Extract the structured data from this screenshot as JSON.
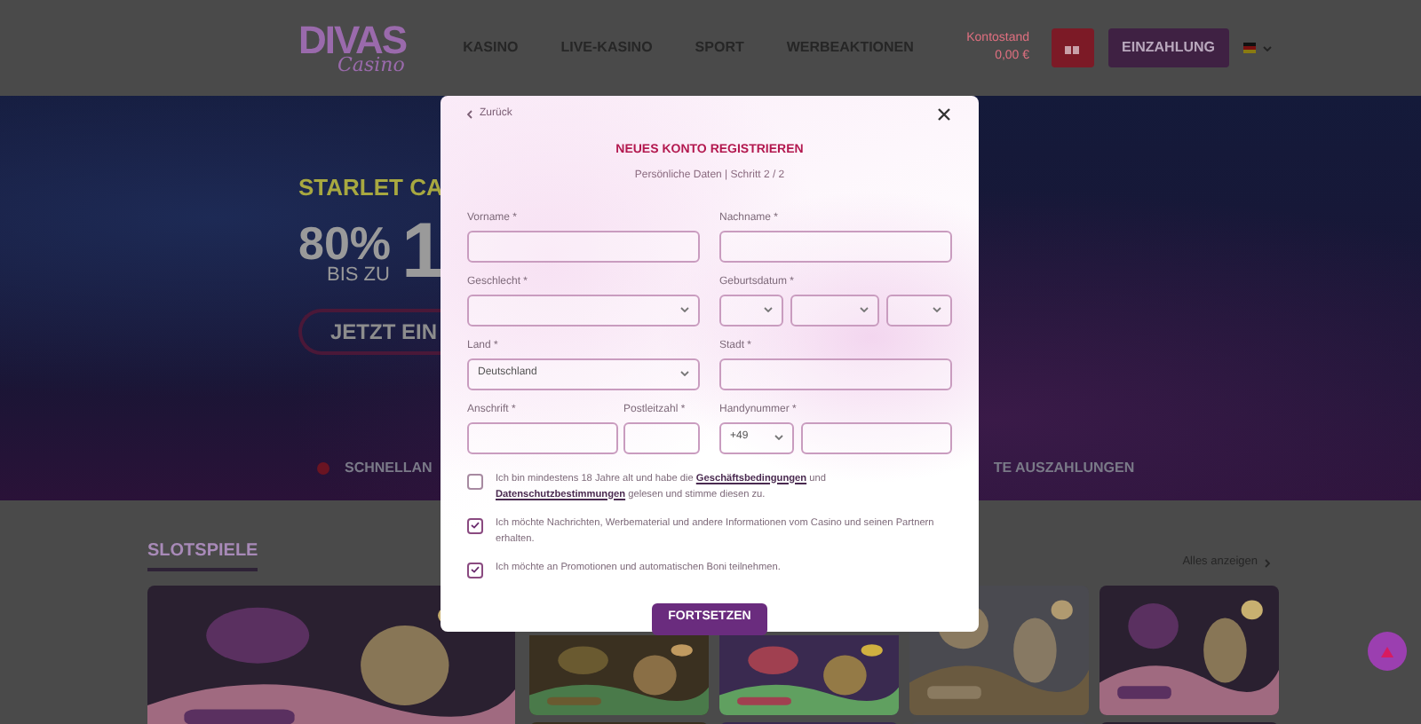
{
  "header": {
    "logo": "DIVAS",
    "logo_sub": "Casino",
    "nav": [
      "KASINO",
      "LIVE-KASINO",
      "SPORT",
      "WERBEAKTIONEN"
    ],
    "balance_label": "Kontostand",
    "balance": "0,00 €",
    "deposit_button": "EINZAHLUNG"
  },
  "hero": {
    "headline": "STARLET CA",
    "percent": "80%",
    "upto": "BIS ZU",
    "amount": "1",
    "cta": "JETZT EIN",
    "features": [
      "SCHNELLAN",
      "TE AUSZAHLUNGEN"
    ]
  },
  "section": {
    "title": "SLOTSPIELE",
    "show_all": "Alles anzeigen"
  },
  "modal": {
    "back": "Zurück",
    "title": "NEUES KONTO REGISTRIEREN",
    "subtitle": "Persönliche Daten | Schritt 2 / 2",
    "rows": [
      [
        {
          "kind": "text",
          "label": "Vorname *"
        },
        {
          "kind": "text",
          "label": "Nachname *"
        }
      ],
      [
        {
          "kind": "select",
          "label": "Geschlecht *"
        },
        {
          "kind": "date",
          "label": "Geburtsdatum *"
        }
      ],
      [
        {
          "kind": "select",
          "label": "Land *",
          "value": "Deutschland"
        },
        {
          "kind": "text",
          "label": "Stadt *"
        }
      ],
      [
        {
          "kind": "text",
          "label": "Anschrift *"
        },
        {
          "kind": "text",
          "label": "Postleitzahl *"
        },
        {
          "kind": "phone",
          "label": "Handynummer *",
          "prefix": "+49"
        }
      ]
    ],
    "consents": [
      {
        "checked": false,
        "parts": [
          {
            "text": "Ich bin mindestens 18 Jahre alt und habe die "
          },
          {
            "text": "Geschäftsbedingungen",
            "kind": "link"
          },
          {
            "text": " und "
          },
          {
            "text": "Datenschutzbestimmungen",
            "kind": "link"
          },
          {
            "text": " gelesen und stimme diesen zu."
          }
        ]
      },
      {
        "checked": true,
        "parts": [
          {
            "text": "Ich möchte Nachrichten, Werbematerial und andere Informationen vom Casino und seinen Partnern erhalten."
          }
        ]
      },
      {
        "checked": true,
        "parts": [
          {
            "text": "Ich möchte an Promotionen und automatischen Boni teilnehmen."
          }
        ]
      }
    ],
    "submit": "FORTSETZEN"
  }
}
